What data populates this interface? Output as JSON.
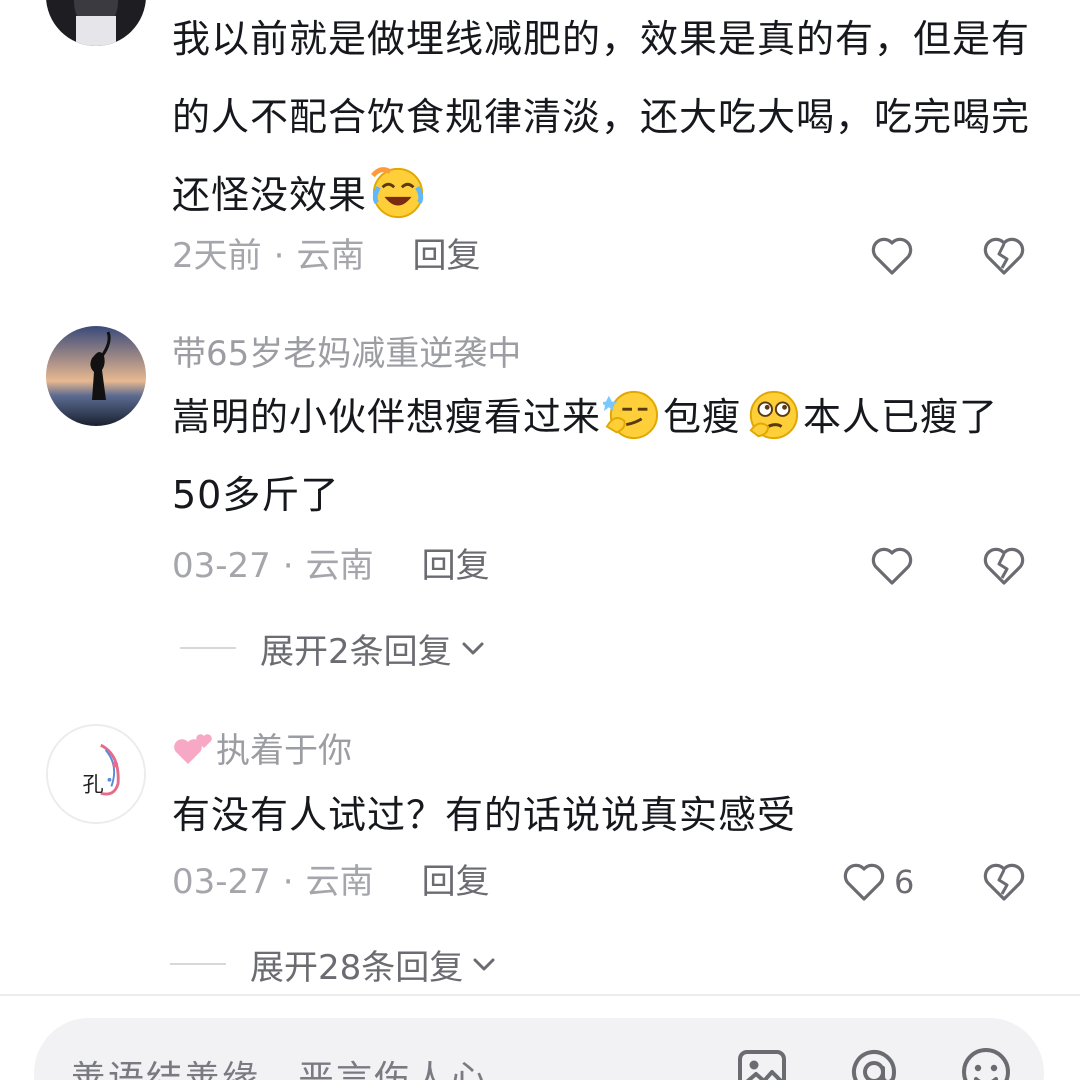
{
  "comments": [
    {
      "text": "我以前就是做埋线减肥的，效果是真的有，但是有的人不配合饮食规律清淡，还大吃大喝，吃完喝完还怪没效果",
      "emoji": "laughing-crying-emoji",
      "time": "2天前",
      "location": "云南",
      "reply_label": "回复"
    },
    {
      "username": "带65岁老妈减重逆袭中",
      "text_parts": [
        "嵩明的小伙伴想瘦看过来",
        "包瘦",
        "本人已瘦了50多斤了"
      ],
      "emojis": [
        "smirk-emoji",
        "thinking-emoji"
      ],
      "time": "03-27",
      "location": "云南",
      "reply_label": "回复",
      "expand_label": "展开2条回复"
    },
    {
      "username_emoji": "two-hearts-emoji",
      "username": "执着于你",
      "avatar_text": "孔",
      "text": "有没有人试过？有的话说说真实感受",
      "time": "03-27",
      "location": "云南",
      "reply_label": "回复",
      "likes": "6",
      "expand_label": "展开28条回复"
    }
  ],
  "separator": "·",
  "input": {
    "placeholder": "善语结善缘，恶言伤人心"
  },
  "icons": [
    "heart-outline-icon",
    "broken-heart-icon",
    "chevron-down-icon",
    "image-icon",
    "at-icon",
    "emoji-icon"
  ],
  "colors": {
    "text": "#16181d",
    "muted": "#a5a5ac",
    "icon": "#6b6b72",
    "input_bg": "#f2f2f4"
  }
}
